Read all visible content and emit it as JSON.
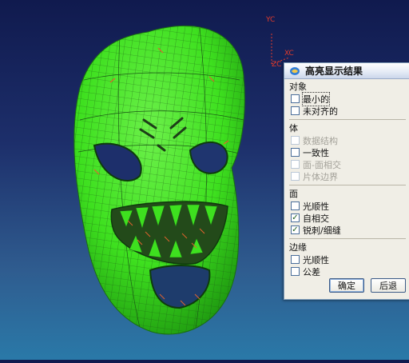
{
  "viewport": {
    "axis_labels": {
      "yc": "YC",
      "xc": "XC",
      "zc": "ZC"
    },
    "colors": {
      "mask_fill": "#3ee01f",
      "mesh_lines": "#1c5a16",
      "highlight_marks": "#e0622e",
      "background_top": "#101a4e",
      "background_bottom": "#2a79a8"
    }
  },
  "dialog": {
    "title": "高亮显示结果",
    "icon": "app-icon",
    "groups": [
      {
        "label": "对象",
        "options": [
          {
            "label": "最小的",
            "checked": false,
            "disabled": false,
            "focused": true
          },
          {
            "label": "未对齐的",
            "checked": false,
            "disabled": false
          }
        ]
      },
      {
        "label": "体",
        "options": [
          {
            "label": "数据结构",
            "checked": false,
            "disabled": true
          },
          {
            "label": "一致性",
            "checked": false,
            "disabled": false
          },
          {
            "label": "面-面相交",
            "checked": false,
            "disabled": true
          },
          {
            "label": "片体边界",
            "checked": false,
            "disabled": true
          }
        ]
      },
      {
        "label": "面",
        "options": [
          {
            "label": "光顺性",
            "checked": false,
            "disabled": false
          },
          {
            "label": "自相交",
            "checked": true,
            "disabled": false
          },
          {
            "label": "锐刺/细缝",
            "checked": true,
            "disabled": false
          }
        ]
      },
      {
        "label": "边缘",
        "options": [
          {
            "label": "光顺性",
            "checked": false,
            "disabled": false
          },
          {
            "label": "公差",
            "checked": false,
            "disabled": false
          }
        ]
      }
    ],
    "buttons": {
      "ok": "确定",
      "back": "后退"
    }
  }
}
